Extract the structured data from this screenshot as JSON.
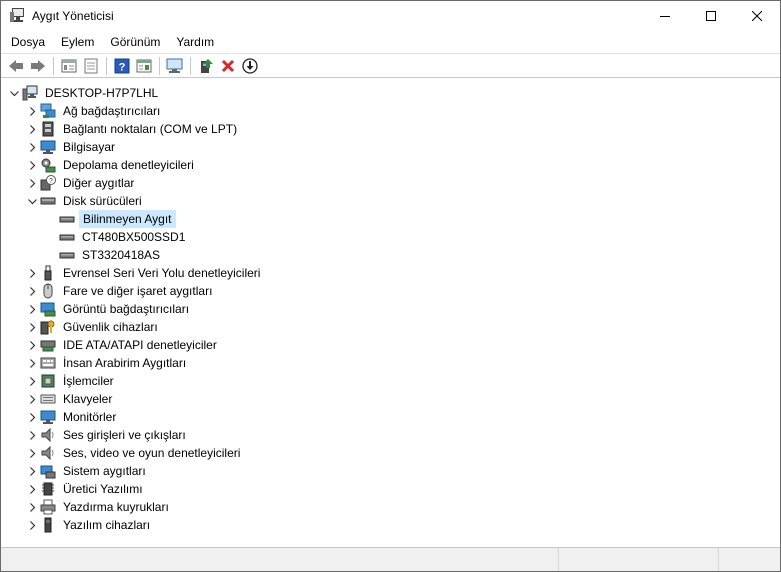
{
  "window": {
    "title": "Aygıt Yöneticisi",
    "controls": {
      "minimize": "—",
      "maximize": "☐",
      "close": "✕"
    }
  },
  "menu": [
    {
      "label": "Dosya"
    },
    {
      "label": "Eylem"
    },
    {
      "label": "Görünüm"
    },
    {
      "label": "Yardım"
    }
  ],
  "toolbar": {
    "buttons": [
      "back-icon",
      "forward-icon",
      "properties-view-icon",
      "device-list-icon",
      "help-icon",
      "action-view-icon",
      "scan-hardware-icon",
      "update-driver-icon",
      "uninstall-icon",
      "disable-device-icon"
    ]
  },
  "tree": {
    "root": {
      "label": "DESKTOP-H7P7LHL",
      "icon": "computer-icon",
      "expanded": true
    },
    "categories": [
      {
        "label": "Ağ bağdaştırıcıları",
        "icon": "network-adapter-icon"
      },
      {
        "label": "Bağlantı noktaları (COM ve LPT)",
        "icon": "port-icon"
      },
      {
        "label": "Bilgisayar",
        "icon": "monitor-icon"
      },
      {
        "label": "Depolama denetleyicileri",
        "icon": "storage-controller-icon"
      },
      {
        "label": "Diğer aygıtlar",
        "icon": "unknown-device-icon"
      },
      {
        "label": "Disk sürücüleri",
        "icon": "disk-drive-icon",
        "expanded": true,
        "children": [
          {
            "label": "Bilinmeyen Aygıt",
            "icon": "disk-drive-icon",
            "selected": true
          },
          {
            "label": "CT480BX500SSD1",
            "icon": "disk-drive-icon"
          },
          {
            "label": "ST3320418AS",
            "icon": "disk-drive-icon"
          }
        ]
      },
      {
        "label": "Evrensel Seri Veri Yolu denetleyicileri",
        "icon": "usb-icon"
      },
      {
        "label": "Fare ve diğer işaret aygıtları",
        "icon": "mouse-icon"
      },
      {
        "label": "Görüntü bağdaştırıcıları",
        "icon": "display-adapter-icon"
      },
      {
        "label": "Güvenlik cihazları",
        "icon": "security-device-icon"
      },
      {
        "label": "IDE ATA/ATAPI denetleyiciler",
        "icon": "ide-controller-icon"
      },
      {
        "label": "İnsan Arabirim Aygıtları",
        "icon": "hid-icon"
      },
      {
        "label": "İşlemciler",
        "icon": "processor-icon"
      },
      {
        "label": "Klavyeler",
        "icon": "keyboard-icon"
      },
      {
        "label": "Monitörler",
        "icon": "monitor-icon"
      },
      {
        "label": "Ses girişleri ve çıkışları",
        "icon": "speaker-icon"
      },
      {
        "label": "Ses, video ve oyun denetleyicileri",
        "icon": "speaker-icon"
      },
      {
        "label": "Sistem aygıtları",
        "icon": "system-device-icon"
      },
      {
        "label": "Üretici Yazılımı",
        "icon": "firmware-icon"
      },
      {
        "label": "Yazdırma kuyrukları",
        "icon": "printer-icon"
      },
      {
        "label": "Yazılım cihazları",
        "icon": "software-device-icon"
      }
    ]
  },
  "colors": {
    "selection": "#cce8ff",
    "accent_blue": "#1e6fc7",
    "uninstall_red": "#d9262b",
    "update_green": "#2e8b3a"
  }
}
